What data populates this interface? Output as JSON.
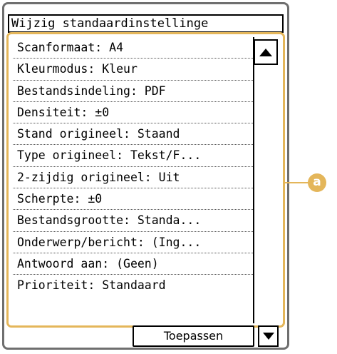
{
  "title": "Wijzig standaardinstellinge",
  "items": [
    {
      "label": "Scanformaat: A4"
    },
    {
      "label": "Kleurmodus: Kleur"
    },
    {
      "label": "Bestandsindeling: PDF"
    },
    {
      "label": "Densiteit: ±0"
    },
    {
      "label": "Stand origineel: Staand"
    },
    {
      "label": "Type origineel: Tekst/F..."
    },
    {
      "label": "2-zijdig origineel: Uit"
    },
    {
      "label": "Scherpte: ±0"
    },
    {
      "label": "Bestandsgrootte: Standa..."
    },
    {
      "label": "Onderwerp/bericht: (Ing..."
    },
    {
      "label": "Antwoord aan: (Geen)"
    },
    {
      "label": "Prioriteit: Standaard"
    }
  ],
  "buttons": {
    "apply": "Toepassen"
  },
  "callout": {
    "letter": "a"
  },
  "colors": {
    "accent": "#e4b65a",
    "frame": "#6f6f6f"
  },
  "icons": {
    "scroll_up": "triangle-up-icon",
    "scroll_down": "triangle-down-icon"
  }
}
